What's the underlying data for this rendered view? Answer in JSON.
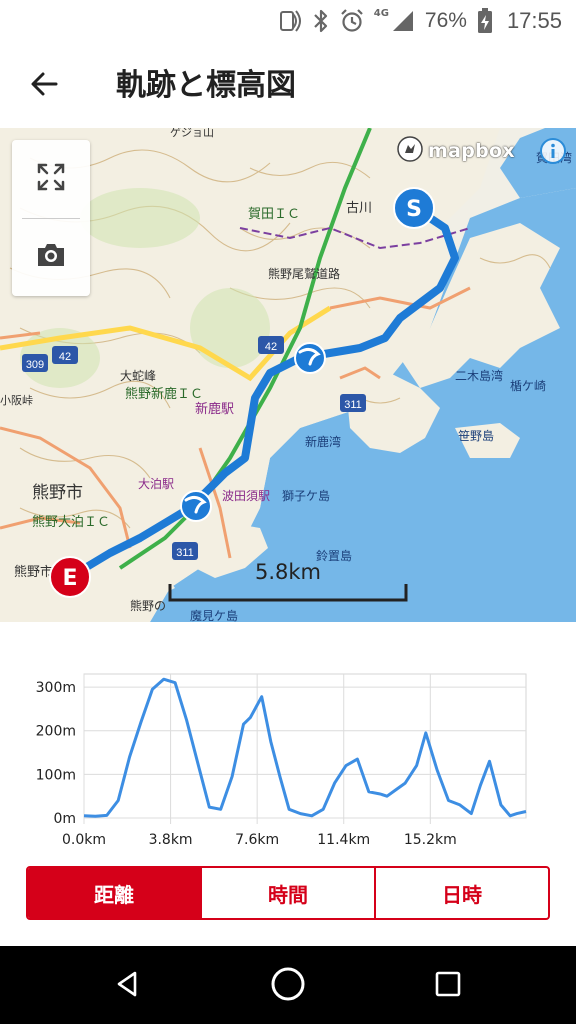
{
  "status_bar": {
    "network": "4G",
    "battery_percent": "76%",
    "time": "17:55",
    "icons": [
      "nfc-icon",
      "bluetooth-icon",
      "alarm-icon",
      "signal-icon",
      "battery-charging-icon"
    ]
  },
  "app_bar": {
    "title": "軌跡と標高図",
    "back_icon": "arrow-back-icon"
  },
  "map": {
    "attribution": "mapbox",
    "scale_label": "5.8km",
    "start_marker": "S",
    "end_marker": "E",
    "route_color": "#1e7bd6",
    "labels": {
      "kumanoshi": "熊野市",
      "kumano_oodomari_ic": "熊野大泊ＩＣ",
      "kumano_shinka_ic": "熊野新鹿ＩＣ",
      "kumanoshi_small": "熊野市",
      "kataku_ic": "賀田ＩＣ",
      "furukawa": "古川",
      "shinka_eki": "新鹿駅",
      "hadasu_eki": "波田須駅",
      "shinka_wan": "新鹿湾",
      "shishigagashima": "獅子ケ島",
      "suzuokijima": "鈴置島",
      "futaki_jima_wan": "二木島湾",
      "sasanojima": "笹野島",
      "kushigasaki": "楯ケ崎",
      "kita_wan": "賀田湾",
      "oodomari_eki": "大泊駅",
      "oshigatake": "大蛇峰",
      "kumanono": "熊野の",
      "makami_gashima": "魔見ケ島",
      "route_42_a": "42",
      "route_42_b": "42",
      "route_309": "309",
      "route_311_a": "311",
      "route_311_b": "311",
      "kumano_ooshine_road": "熊野尾鷲道路",
      "osaka_pass": "小阪峠",
      "ketaguchi": "ゲジョ山"
    }
  },
  "chart_data": {
    "type": "line",
    "title": "",
    "xlabel": "",
    "ylabel": "",
    "xlim": [
      0,
      19.4
    ],
    "ylim": [
      0,
      330
    ],
    "x_ticks": [
      "0.0km",
      "3.8km",
      "7.6km",
      "11.4km",
      "15.2km"
    ],
    "y_ticks": [
      "0m",
      "100m",
      "200m",
      "300m"
    ],
    "grid": true,
    "series_color": "#3d8ee3",
    "x": [
      0.0,
      0.5,
      1.0,
      1.5,
      2.0,
      2.5,
      3.0,
      3.5,
      4.0,
      4.5,
      5.0,
      5.5,
      6.0,
      6.5,
      7.0,
      7.3,
      7.8,
      8.2,
      8.6,
      9.0,
      9.5,
      10.0,
      10.5,
      11.0,
      11.5,
      12.0,
      12.5,
      13.0,
      13.3,
      13.7,
      14.1,
      14.6,
      15.0,
      15.5,
      16.0,
      16.5,
      17.0,
      17.4,
      17.8,
      18.3,
      18.7,
      19.0,
      19.4
    ],
    "y": [
      5,
      4,
      6,
      40,
      140,
      220,
      295,
      318,
      310,
      225,
      125,
      25,
      20,
      95,
      215,
      230,
      278,
      175,
      95,
      20,
      10,
      5,
      20,
      80,
      120,
      135,
      60,
      55,
      50,
      65,
      80,
      120,
      195,
      110,
      40,
      30,
      10,
      75,
      130,
      30,
      5,
      10,
      15
    ]
  },
  "tabs": {
    "distance": "距離",
    "time": "時間",
    "datetime": "日時"
  },
  "nav": {
    "back": "back-triangle-icon",
    "home": "home-circle-icon",
    "recents": "recents-square-icon"
  }
}
